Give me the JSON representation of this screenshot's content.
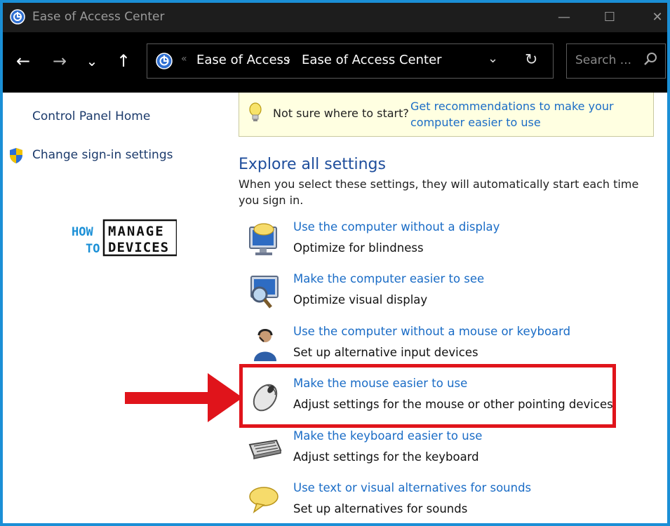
{
  "window": {
    "title": "Ease of Access Center",
    "controls": {
      "minimize": "—",
      "maximize": "☐",
      "close": "✕"
    }
  },
  "navigation": {
    "back": "←",
    "forward": "→",
    "recent": "⌄",
    "up": "↑",
    "breadcrumb_separator_start": "«",
    "breadcrumb": [
      "Ease of Access",
      "Ease of Access Center"
    ],
    "breadcrumb_separator": "›",
    "dropdown": "⌄",
    "refresh": "↻",
    "search_placeholder": "Search ..."
  },
  "sidebar": {
    "links": [
      {
        "label": "Control Panel Home"
      },
      {
        "label": "Change sign-in settings",
        "icon": "shield-icon"
      }
    ],
    "logo": {
      "line1a": "HOW",
      "line1b": "MANAGE",
      "line2a": "TO",
      "line2b": "DEVICES"
    }
  },
  "tip": {
    "question": "Not sure where to start?",
    "link": "Get recommendations to make your computer easier to use"
  },
  "main": {
    "heading": "Explore all settings",
    "description": "When you select these settings, they will automatically start each time you sign in.",
    "items": [
      {
        "link": "Use the computer without a display",
        "sub": "Optimize for blindness",
        "icon": "speech-monitor-icon"
      },
      {
        "link": "Make the computer easier to see",
        "sub": "Optimize visual display",
        "icon": "magnifier-monitor-icon"
      },
      {
        "link": "Use the computer without a mouse or keyboard",
        "sub": "Set up alternative input devices",
        "icon": "headset-user-icon"
      },
      {
        "link": "Make the mouse easier to use",
        "sub": "Adjust settings for the mouse or other pointing devices",
        "icon": "mouse-icon"
      },
      {
        "link": "Make the keyboard easier to use",
        "sub": "Adjust settings for the keyboard",
        "icon": "keyboard-icon"
      },
      {
        "link": "Use text or visual alternatives for sounds",
        "sub": "Set up alternatives for sounds",
        "icon": "speech-bubble-icon"
      }
    ]
  },
  "colors": {
    "link": "#1a6cc6",
    "heading": "#1f4e9c",
    "highlight": "#e0141b",
    "border": "#1a8fd6"
  }
}
